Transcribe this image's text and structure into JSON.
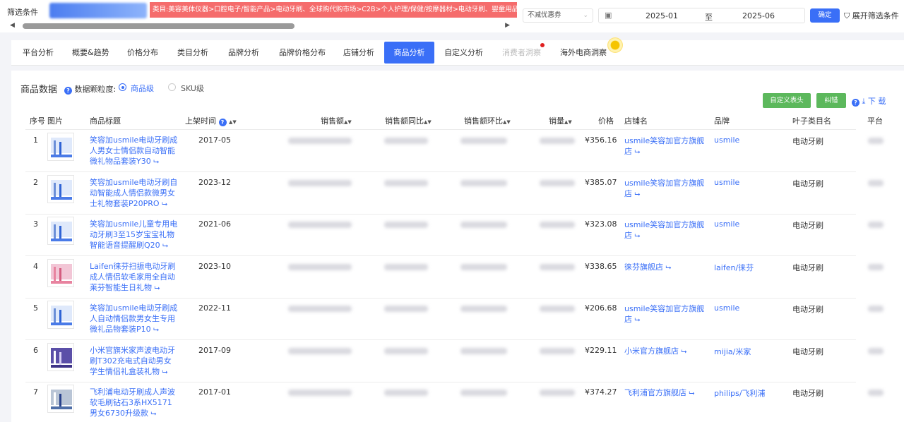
{
  "filter": {
    "label": "筛选条件",
    "category_path": "类目:美容美体仪器>口腔电子/智能产品>电动牙刷、全球购代购市场>C2B>个人护理/保健/按摩器材>电动牙刷、婴童用品>婴童口腔",
    "coupon": "不减优惠券",
    "date_start": "2025-01",
    "date_sep": "至",
    "date_end": "2025-06",
    "ok": "确定",
    "expand": "展开筛选条件"
  },
  "tabs": [
    {
      "label": "平台分析"
    },
    {
      "label": "概要&趋势"
    },
    {
      "label": "价格分布"
    },
    {
      "label": "类目分析"
    },
    {
      "label": "品牌分析"
    },
    {
      "label": "品牌价格分布"
    },
    {
      "label": "店铺分析"
    },
    {
      "label": "商品分析"
    },
    {
      "label": "自定义分析"
    },
    {
      "label": "消费者洞察"
    },
    {
      "label": "海外电商洞察"
    }
  ],
  "active_tab": "商品分析",
  "panel": {
    "title": "商品数据",
    "granularity_label": "数据颗粒度:",
    "option_product": "商品级",
    "option_sku": "SKU级",
    "custom_header": "自定义表头",
    "correction": "纠错",
    "download": "下 载"
  },
  "columns": {
    "index": "序号",
    "image": "图片",
    "title": "商品标题",
    "listed": "上架时间",
    "sales": "销售额",
    "yoy": "销售额同比",
    "mom": "销售额环比",
    "volume": "销量",
    "price": "价格",
    "shop": "店铺名",
    "brand": "品牌",
    "leaf": "叶子类目名",
    "platform": "平台"
  },
  "rows": [
    {
      "index": "1",
      "title": "笑容加usmile电动牙刷成人男女士情侣款自动智能微礼物品套装Y30",
      "listed": "2017-05",
      "price": "¥356.16",
      "shop": "usmile笑容加官方旗舰店",
      "brand": "usmile",
      "leaf": "电动牙刷",
      "thumb": "blue"
    },
    {
      "index": "2",
      "title": "笑容加usmile电动牙刷自动智能成人情侣款微男女士礼物套装P20PRO",
      "listed": "2023-12",
      "price": "¥385.07",
      "shop": "usmile笑容加官方旗舰店",
      "brand": "usmile",
      "leaf": "电动牙刷",
      "thumb": "blue"
    },
    {
      "index": "3",
      "title": "笑容加usmile儿童专用电动牙刷3至15岁宝宝礼物智能语音提醒刷Q20",
      "listed": "2021-06",
      "price": "¥323.08",
      "shop": "usmile笑容加官方旗舰店",
      "brand": "usmile",
      "leaf": "电动牙刷",
      "thumb": "blue"
    },
    {
      "index": "4",
      "title": "Laifen徕芬扫振电动牙刷成人情侣软毛家用全自动莱芬智能生日礼物",
      "listed": "2023-10",
      "price": "¥338.65",
      "shop": "徕芬旗舰店",
      "brand": "laifen/徕芬",
      "leaf": "电动牙刷",
      "thumb": "pink"
    },
    {
      "index": "5",
      "title": "笑容加usmile电动牙刷成人自动情侣款男女生专用微礼品物套装P10",
      "listed": "2022-11",
      "price": "¥206.68",
      "shop": "usmile笑容加官方旗舰店",
      "brand": "usmile",
      "leaf": "电动牙刷",
      "thumb": "blue"
    },
    {
      "index": "6",
      "title": "小米官旗米家声波电动牙刷T302充电式自动男女学生情侣礼盒装礼物",
      "listed": "2017-09",
      "price": "¥229.11",
      "shop": "小米官方旗舰店",
      "brand": "mijia/米家",
      "leaf": "电动牙刷",
      "thumb": "purple"
    },
    {
      "index": "7",
      "title": "飞利浦电动牙刷成人声波软毛刷钻石3系HX5171男女6730升级款",
      "listed": "2017-01",
      "price": "¥374.27",
      "shop": "飞利浦官方旗舰店",
      "brand": "philips/飞利浦",
      "leaf": "电动牙刷",
      "thumb": "grey"
    }
  ]
}
